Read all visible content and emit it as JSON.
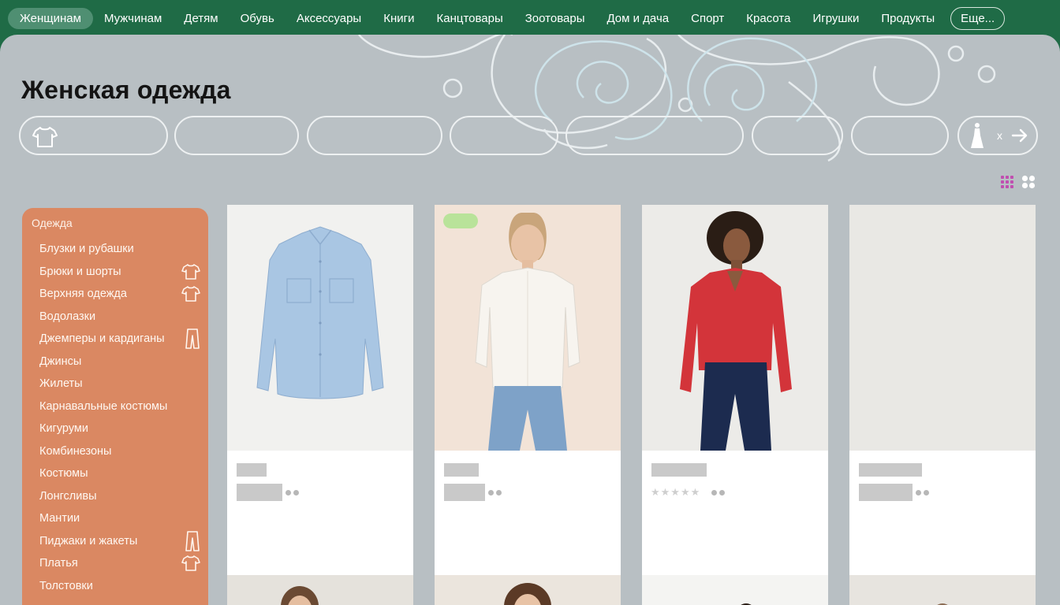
{
  "colors": {
    "nav_bg": "#1f6b46",
    "nav_active": "#4f8f72",
    "panel_bg": "#b8bfc3",
    "sidebar_bg": "#da8862",
    "badge": "#b9e39a",
    "view_toggle_active": "#c04fb0"
  },
  "nav": {
    "items": [
      {
        "label": "Женщинам",
        "active": true
      },
      {
        "label": "Мужчинам"
      },
      {
        "label": "Детям"
      },
      {
        "label": "Обувь"
      },
      {
        "label": "Аксессуары"
      },
      {
        "label": "Книги"
      },
      {
        "label": "Канцтовары"
      },
      {
        "label": "Зоотовары"
      },
      {
        "label": "Дом и дача"
      },
      {
        "label": "Спорт"
      },
      {
        "label": "Красота"
      },
      {
        "label": "Игрушки"
      },
      {
        "label": "Продукты"
      }
    ],
    "more_label": "Еще..."
  },
  "page": {
    "title": "Женская одежда"
  },
  "filter_chips": {
    "first_icon": "tshirt-icon",
    "last_icon": "dress-icon",
    "last_close": "x",
    "last_arrow_icon": "arrow-right-icon"
  },
  "view_toggle": {
    "grid_small_icon": "grid-9-icon",
    "grid_large_icon": "grid-4-icon"
  },
  "sidebar": {
    "header": "Одежда",
    "items": [
      {
        "label": "Блузки и рубашки",
        "icon": ""
      },
      {
        "label": "Брюки и шорты",
        "icon": "tshirt-icon"
      },
      {
        "label": "Верхняя одежда",
        "icon": "tshirt-icon"
      },
      {
        "label": "Водолазки",
        "icon": ""
      },
      {
        "label": "Джемперы и кардиганы",
        "icon": "trousers-icon"
      },
      {
        "label": "Джинсы",
        "icon": ""
      },
      {
        "label": "Жилеты",
        "icon": ""
      },
      {
        "label": "Карнавальные костюмы",
        "icon": ""
      },
      {
        "label": "Кигуруми",
        "icon": ""
      },
      {
        "label": "Комбинезоны",
        "icon": ""
      },
      {
        "label": "Костюмы",
        "icon": ""
      },
      {
        "label": "Лонгсливы",
        "icon": ""
      },
      {
        "label": "Мантии",
        "icon": ""
      },
      {
        "label": "Пиджаки и жакеты",
        "icon": "trousers-icon"
      },
      {
        "label": "Платья",
        "icon": "tshirt-icon"
      },
      {
        "label": "Толстовки",
        "icon": ""
      }
    ]
  },
  "products": [
    {
      "image": "denim-shirt",
      "badge": false,
      "rating_stars": false
    },
    {
      "image": "woman-white-shirt",
      "badge": true,
      "rating_stars": false
    },
    {
      "image": "woman-red-blouse",
      "badge": false,
      "rating_stars": true
    },
    {
      "image": "empty-image",
      "badge": false,
      "rating_stars": false
    }
  ]
}
